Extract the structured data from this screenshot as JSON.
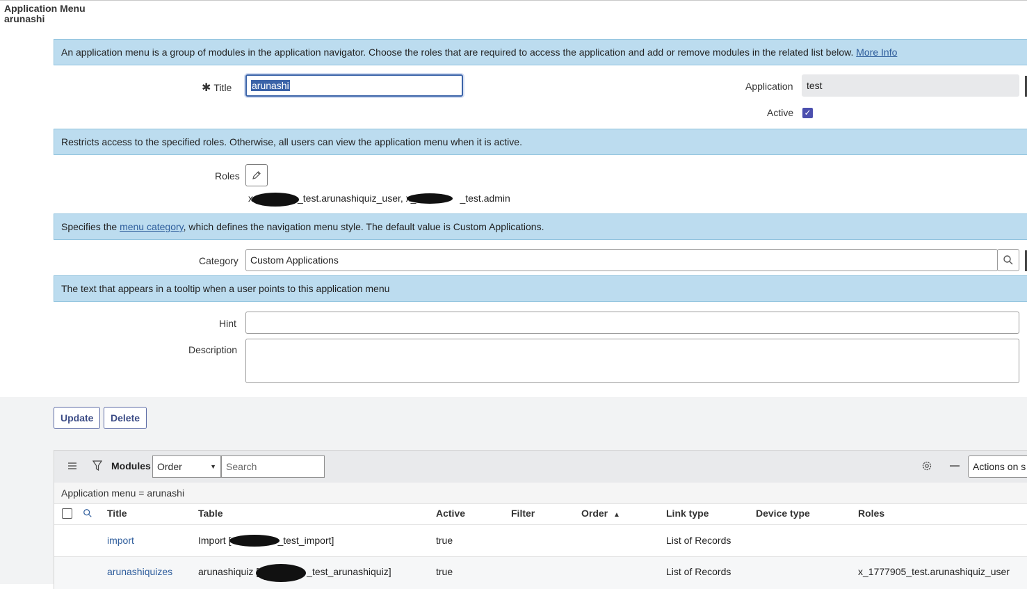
{
  "header": {
    "title": "Application Menu",
    "record": "arunashi"
  },
  "form": {
    "info_main": "An application menu is a group of modules in the application navigator. Choose the roles that are required to access the application and add or remove modules in the related list below.",
    "more_info_link": "More Info",
    "title_label": "Title",
    "title_value": "arunashi",
    "application_label": "Application",
    "application_value": "test",
    "active_label": "Active",
    "active_checked": true,
    "info_roles": "Restricts access to the specified roles. Otherwise, all users can view the application menu when it is active.",
    "roles_label": "Roles",
    "roles_part1": "x",
    "roles_part2": "_test.arunashiquiz_user, x_",
    "roles_part3": "_test.admin",
    "info_category_prefix": "Specifies the ",
    "info_category_link": "menu category",
    "info_category_suffix": ", which defines the navigation menu style. The default value is Custom Applications.",
    "category_label": "Category",
    "category_value": "Custom Applications",
    "info_hint": "The text that appears in a tooltip when a user points to this application menu",
    "hint_label": "Hint",
    "hint_value": "",
    "description_label": "Description",
    "description_value": ""
  },
  "buttons": {
    "update": "Update",
    "delete": "Delete"
  },
  "related_list": {
    "title": "Modules",
    "search_field_select": "Order",
    "search_placeholder": "Search",
    "actions_label": "Actions on s",
    "breadcrumb": "Application menu = arunashi",
    "columns": [
      "Title",
      "Table",
      "Active",
      "Filter",
      "Order",
      "Link type",
      "Device type",
      "Roles"
    ],
    "sort_indicator": "▲",
    "rows": [
      {
        "title": "import",
        "table_prefix": "Import [",
        "table_suffix": "_test_import]",
        "active": "true",
        "filter": "",
        "order": "",
        "link_type": "List of Records",
        "device_type": "",
        "roles": ""
      },
      {
        "title": "arunashiquizes",
        "table_prefix": "arunashiquiz [",
        "table_suffix": "_test_arunashiquiz]",
        "active": "true",
        "filter": "",
        "order": "",
        "link_type": "List of Records",
        "device_type": "",
        "roles": "x_1777905_test.arunashiquiz_user"
      }
    ]
  },
  "colors": {
    "info_bg": "#bcdcef",
    "accent": "#3b63a8",
    "checkbox": "#4b4fae",
    "link": "#2d5c9b"
  }
}
